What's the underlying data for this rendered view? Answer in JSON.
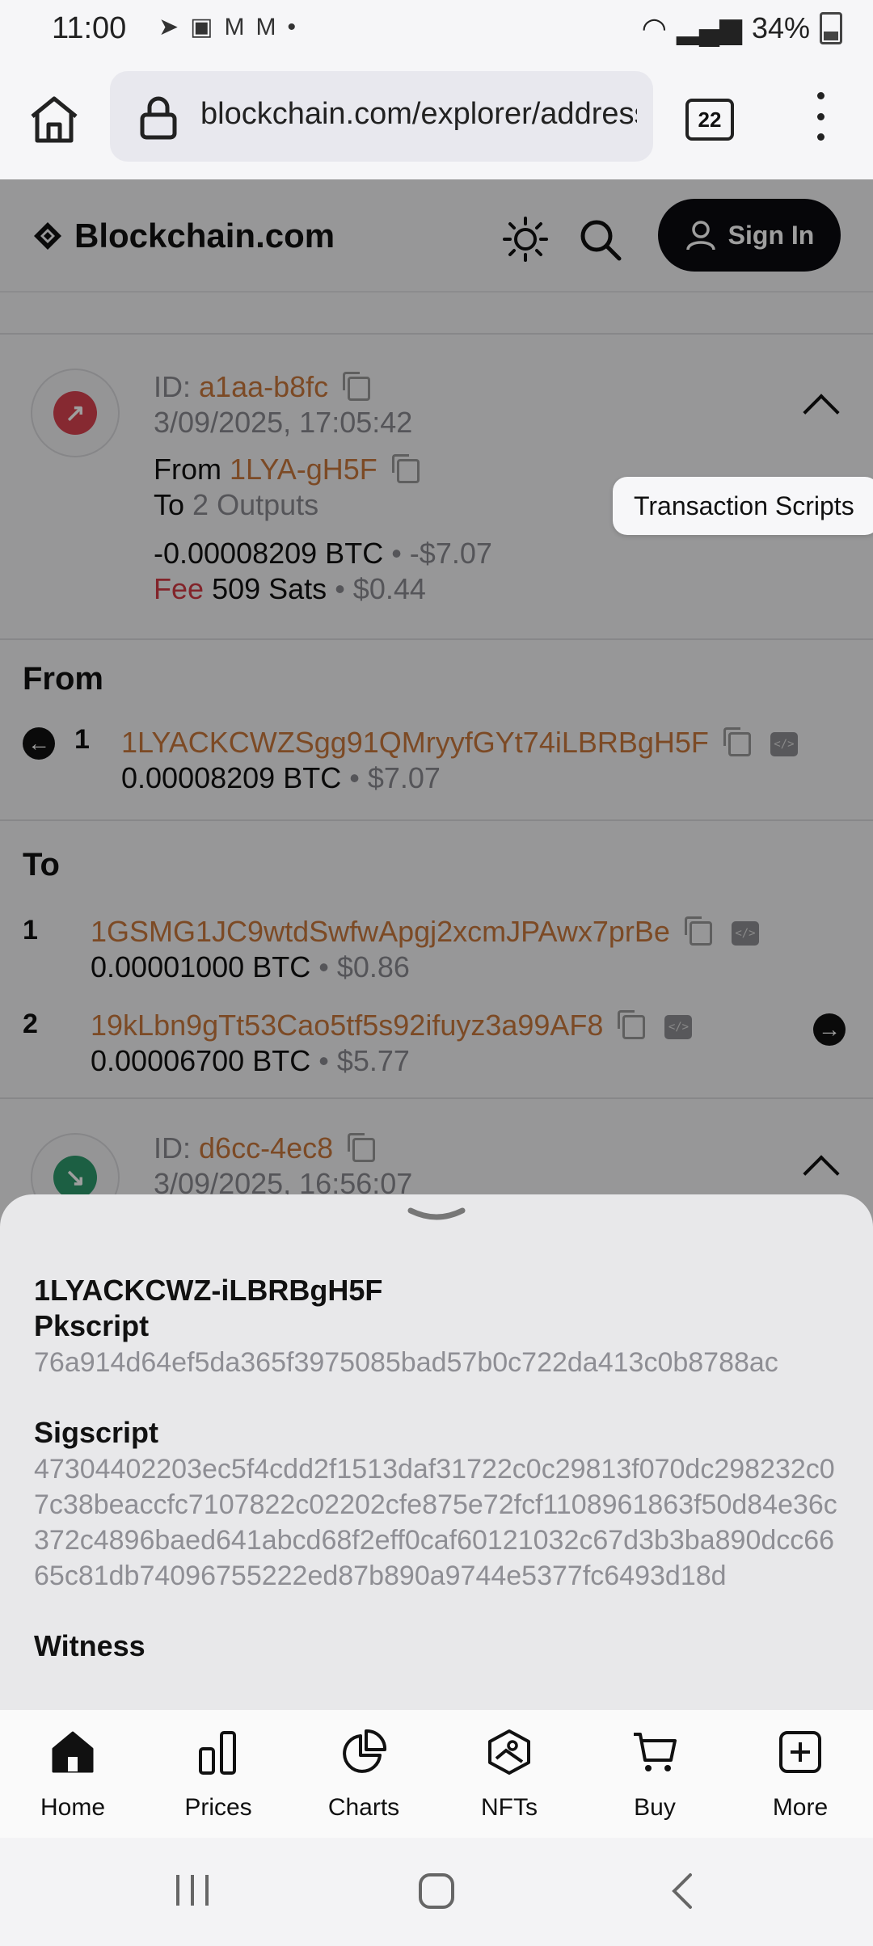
{
  "status": {
    "time": "11:00",
    "battery": "34%"
  },
  "browser": {
    "url": "blockchain.com/explorer/address",
    "tab_count": "22"
  },
  "site": {
    "brand": "Blockchain.com",
    "signin_label": "Sign In"
  },
  "tx1": {
    "id_label": "ID:",
    "id": "a1aa-b8fc",
    "date": "3/09/2025, 17:05:42",
    "from_label": "From",
    "from_addr": "1LYA-gH5F",
    "to_label": "To",
    "to_value": "2 Outputs",
    "amount": "-0.00008209 BTC",
    "amount_usd": "• -$7.07",
    "fee_label": "Fee",
    "fee_value": "509 Sats",
    "fee_usd": "• $0.44"
  },
  "from_section": {
    "title": "From",
    "index": "1",
    "address": "1LYACKCWZSgg91QMryyfGYt74iLBRBgH5F",
    "amount": "0.00008209 BTC",
    "usd": "• $7.07"
  },
  "tooltip": "Transaction Scripts",
  "to_section": {
    "title": "To",
    "outputs": [
      {
        "index": "1",
        "address": "1GSMG1JC9wtdSwfwApgj2xcmJPAwx7prBe",
        "amount": "0.00001000 BTC",
        "usd": "• $0.86"
      },
      {
        "index": "2",
        "address": "19kLbn9gTt53Cao5tf5s92ifuyz3a99AF8",
        "amount": "0.00006700 BTC",
        "usd": "• $5.77"
      }
    ]
  },
  "tx2": {
    "id_label": "ID:",
    "id": "d6cc-4ec8",
    "date": "3/09/2025, 16:56:07"
  },
  "sheet": {
    "title": "1LYACKCWZ-iLBRBgH5F",
    "pkscript_label": "Pkscript",
    "pkscript": "76a914d64ef5da365f3975085bad57b0c722da413c0b8788ac",
    "sigscript_label": "Sigscript",
    "sigscript": "47304402203ec5f4cdd2f1513daf31722c0c29813f070dc298232c07c38beaccfc7107822c02202cfe875e72fcf1108961863f50d84e36c372c4896baed641abcd68f2eff0caf60121032c67d3b3ba890dcc6665c81db74096755222ed87b890a9744e5377fc6493d18d",
    "witness_label": "Witness"
  },
  "nav": [
    "Home",
    "Prices",
    "Charts",
    "NFTs",
    "Buy",
    "More"
  ],
  "colors": {
    "accent_orange": "#c9783d",
    "fee_red": "#d23a44",
    "sent_red": "#d8434f",
    "received_green": "#2e9a6d"
  }
}
